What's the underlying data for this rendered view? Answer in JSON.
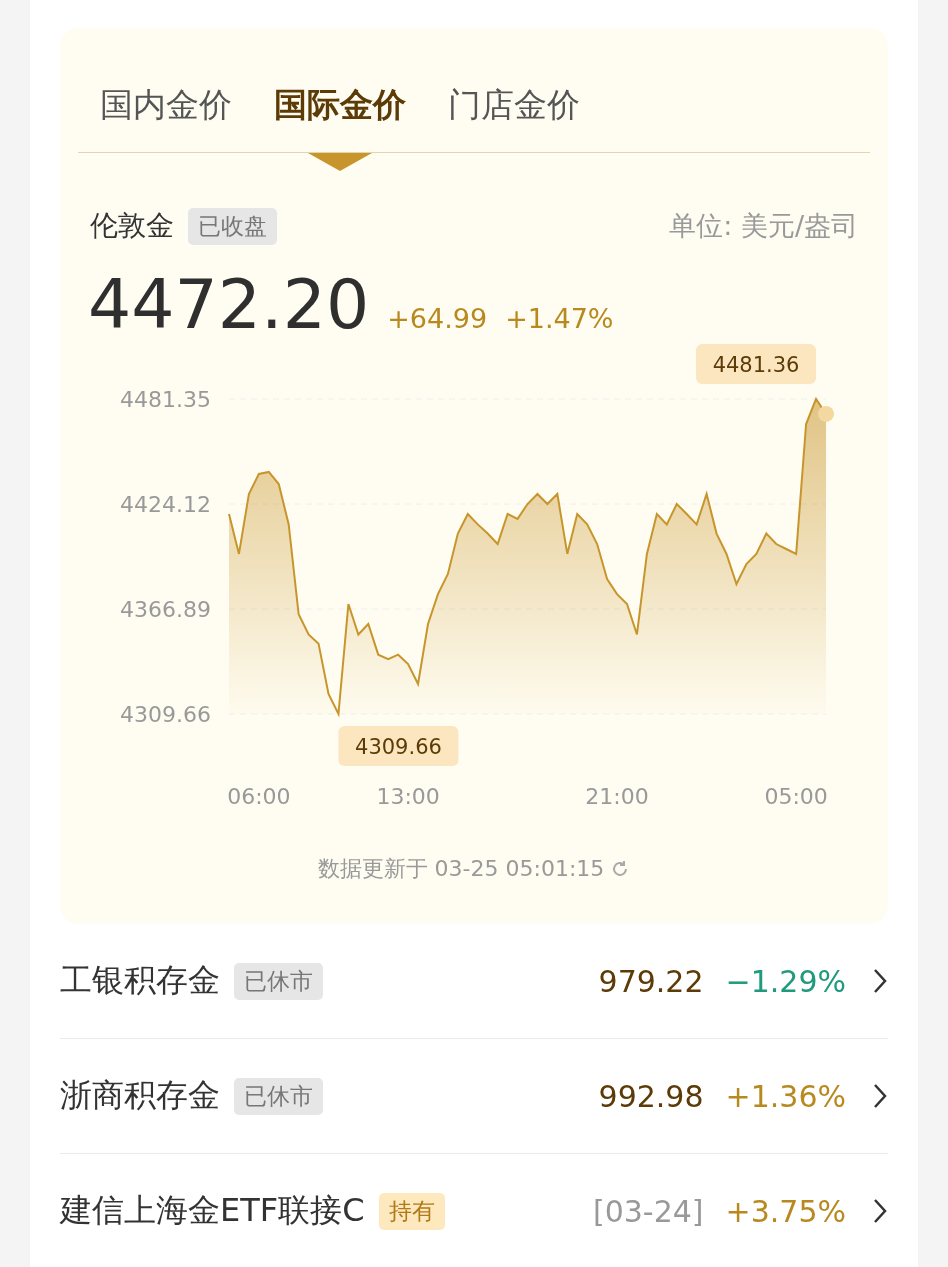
{
  "tabs": [
    {
      "label": "国内金价",
      "selected": false
    },
    {
      "label": "国际金价",
      "selected": true
    },
    {
      "label": "门店金价",
      "selected": false
    }
  ],
  "quote": {
    "name": "伦敦金",
    "status": "已收盘",
    "unit": "单位: 美元/盎司",
    "price": "4472.20",
    "change": "+64.99",
    "change_pct": "+1.47%",
    "chart_data": {
      "type": "area",
      "grid": true,
      "ylim": [
        4309.66,
        4481.35
      ],
      "categories": [
        null,
        null,
        null,
        "06:00",
        null,
        null,
        null,
        null,
        null,
        null,
        null,
        null,
        null,
        null,
        null,
        null,
        null,
        null,
        "13:00",
        null,
        null,
        null,
        null,
        null,
        null,
        null,
        null,
        null,
        null,
        null,
        null,
        null,
        null,
        null,
        null,
        null,
        null,
        null,
        null,
        "21:00",
        null,
        null,
        null,
        null,
        null,
        null,
        null,
        null,
        null,
        null,
        null,
        null,
        null,
        null,
        null,
        null,
        null,
        "05:00",
        null,
        null,
        null
      ],
      "yticks": [
        {
          "value": 4481.35,
          "label": "4481.35"
        },
        {
          "value": 4424.12,
          "label": "4424.12"
        },
        {
          "value": 4366.89,
          "label": "4366.89"
        },
        {
          "value": 4309.66,
          "label": "4309.66"
        }
      ],
      "series": [
        {
          "color": "#c8952c",
          "values": [
            4418.7,
            4396.9,
            4429.6,
            4440.5,
            4441.6,
            4435,
            4413,
            4364,
            4353,
            4348,
            4320.6,
            4309.66,
            4369.6,
            4353,
            4358.7,
            4342,
            4339.6,
            4342,
            4336.9,
            4326,
            4358.7,
            4375,
            4386,
            4408,
            4418.7,
            4413,
            4408,
            4402.3,
            4418.7,
            4416,
            4424.1,
            4429.6,
            4424.1,
            4429.6,
            4396.9,
            4418.7,
            4413,
            4402.3,
            4383.2,
            4375,
            4369.6,
            4353,
            4396.9,
            4418.7,
            4413,
            4424.1,
            4418.7,
            4413,
            4429.6,
            4408,
            4396.9,
            4380.5,
            4391.4,
            4396.9,
            4408,
            4402.3,
            4399.6,
            4396.9,
            4467.7,
            4481.35,
            4473.2
          ]
        }
      ],
      "annotations": [
        "4481.36",
        "4309.66"
      ]
    },
    "updated": "数据更新于 03-25 05:01:15"
  },
  "products": [
    {
      "name": "工银积存金",
      "tag": {
        "text": "已休市",
        "kind": "closed"
      },
      "price": "979.22",
      "change": "−1.29%",
      "color": "#1f9a7c"
    },
    {
      "name": "浙商积存金",
      "tag": {
        "text": "已休市",
        "kind": "closed"
      },
      "price": "992.98",
      "change": "+1.36%",
      "color": "#b8891f"
    },
    {
      "name": "建信上海金ETF联接C",
      "tag": {
        "text": "持有",
        "kind": "held"
      },
      "date": "[03-24]",
      "change": "+3.75%",
      "color": "#b8891f"
    }
  ]
}
